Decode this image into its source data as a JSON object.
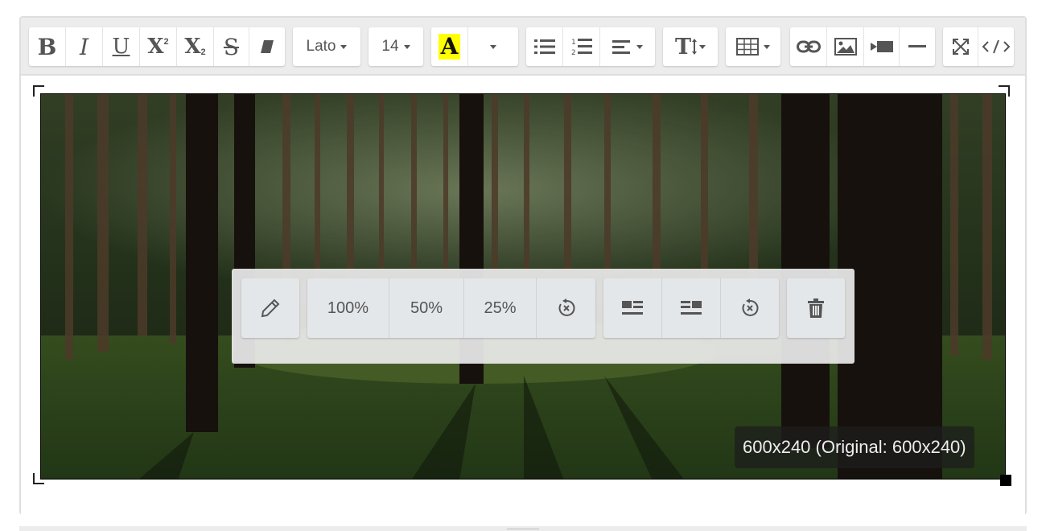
{
  "toolbar": {
    "style_buttons": [
      {
        "name": "bold",
        "label": "B"
      },
      {
        "name": "italic",
        "label": "I"
      },
      {
        "name": "underline",
        "label": "U"
      },
      {
        "name": "superscript",
        "label": "X"
      },
      {
        "name": "subscript",
        "label": "X"
      },
      {
        "name": "strikethrough",
        "label": "S"
      },
      {
        "name": "eraser-icon"
      }
    ],
    "font_name": "Lato",
    "font_size": "14",
    "color_button_label": "A",
    "highlight_color": "#ffff00",
    "text_height_label": "T"
  },
  "image": {
    "dimensions_label": "600x240 (Original: 600x240)"
  },
  "image_popover": {
    "resize_full": "100%",
    "resize_half": "50%",
    "resize_quarter": "25%"
  },
  "colors": {
    "toolbar_bg": "#ececec",
    "button_bg": "#ffffff",
    "icon_color": "#555555",
    "popover_button_bg": "#e4e7ea"
  }
}
